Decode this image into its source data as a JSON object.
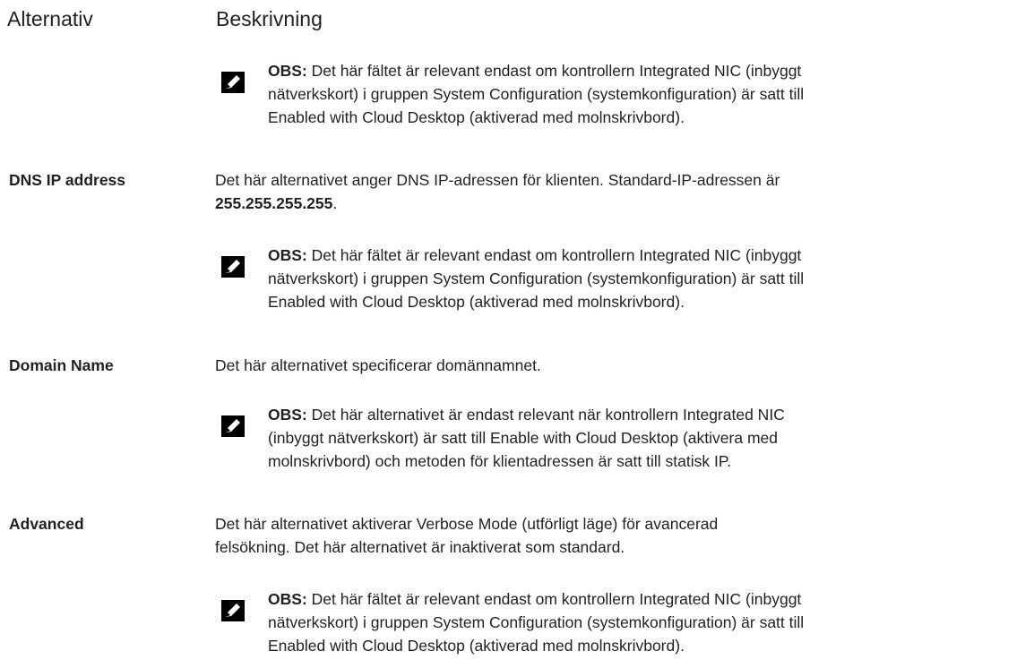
{
  "header": {
    "option_label": "Alternativ",
    "description_label": "Beskrivning"
  },
  "notes": {
    "label": "OBS:",
    "n1": [
      "Det här fältet är relevant endast om kontrollern Integrated NIC (inbyggt",
      "nätverkskort) i gruppen System Configuration (systemkonfiguration) är satt till",
      "Enabled with Cloud Desktop (aktiverad med molnskrivbord)."
    ],
    "n2": [
      "Det här fältet är relevant endast om kontrollern Integrated NIC (inbyggt",
      "nätverkskort) i gruppen System Configuration (systemkonfiguration) är satt till",
      "Enabled with Cloud Desktop (aktiverad med molnskrivbord)."
    ],
    "n3": [
      "Det här alternativet är endast relevant när kontrollern Integrated NIC",
      "(inbyggt nätverkskort) är satt till Enable with Cloud Desktop (aktivera med",
      "molnskrivbord) och metoden för klientadressen är satt till statisk IP."
    ],
    "n4": [
      "Det här fältet är relevant endast om kontrollern Integrated NIC (inbyggt",
      "nätverkskort) i gruppen System Configuration (systemkonfiguration) är satt till",
      "Enabled with Cloud Desktop (aktiverad med molnskrivbord)."
    ]
  },
  "rows": {
    "dns": {
      "name": "DNS IP address",
      "line1": "Det här alternativet anger DNS IP-adressen för klienten. Standard-IP-adressen är",
      "value": "255.255.255.255",
      "suffix": "."
    },
    "domain": {
      "name": "Domain Name",
      "line1": "Det här alternativet specificerar domännamnet."
    },
    "advanced": {
      "name": "Advanced",
      "line1": "Det här alternativet aktiverar Verbose Mode (utförligt läge) för avancerad",
      "line2": "felsökning. Det här alternativet är inaktiverat som standard."
    }
  }
}
